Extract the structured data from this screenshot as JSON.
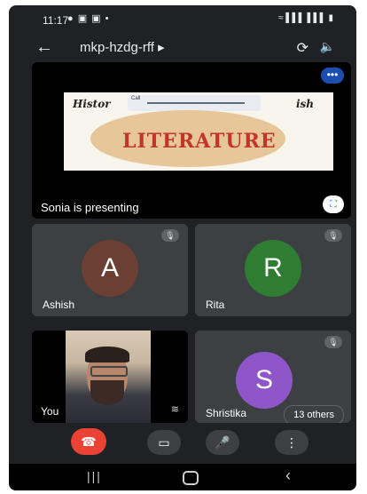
{
  "status_bar": {
    "time": "11:17",
    "left_icons_text": "● ▣ ▣ •",
    "right_icons_text": "≈ ▌▌▌ ▌▌▌ ▮"
  },
  "app_bar": {
    "back_icon": "arrow-left-icon",
    "meeting_code": "mkp-hzdg-rff ▸",
    "camera_flip_icon": "camera-flip-icon",
    "speaker_icon": "speaker-icon"
  },
  "presentation": {
    "presenter_label": "Sonia is presenting",
    "more_icon": "more-horizontal-icon",
    "fullscreen_icon": "fullscreen-icon",
    "slide_title_left": "Histor",
    "slide_title_right": "ish",
    "slide_image_text": "LITERATURE",
    "call_bar_label": "Call"
  },
  "participants": [
    {
      "name": "Ashish",
      "initial": "A",
      "color": "#6b3f31",
      "muted": true
    },
    {
      "name": "Rita",
      "initial": "R",
      "color": "#2e7d32",
      "muted": true
    }
  ],
  "self_tile": {
    "label": "You"
  },
  "others_tile": {
    "name": "Shristika",
    "initial": "S",
    "color": "#8e56c8",
    "muted": true,
    "others_count_label": "13 others"
  },
  "controls": {
    "end_call_icon": "end-call-icon",
    "camera_icon": "video-camera-icon",
    "mic_icon": "microphone-icon",
    "more_icon": "more-vertical-icon"
  },
  "colors": {
    "background": "#202124",
    "tile": "#3c4043",
    "end_call": "#ea4335",
    "accent": "#1a73e8"
  }
}
